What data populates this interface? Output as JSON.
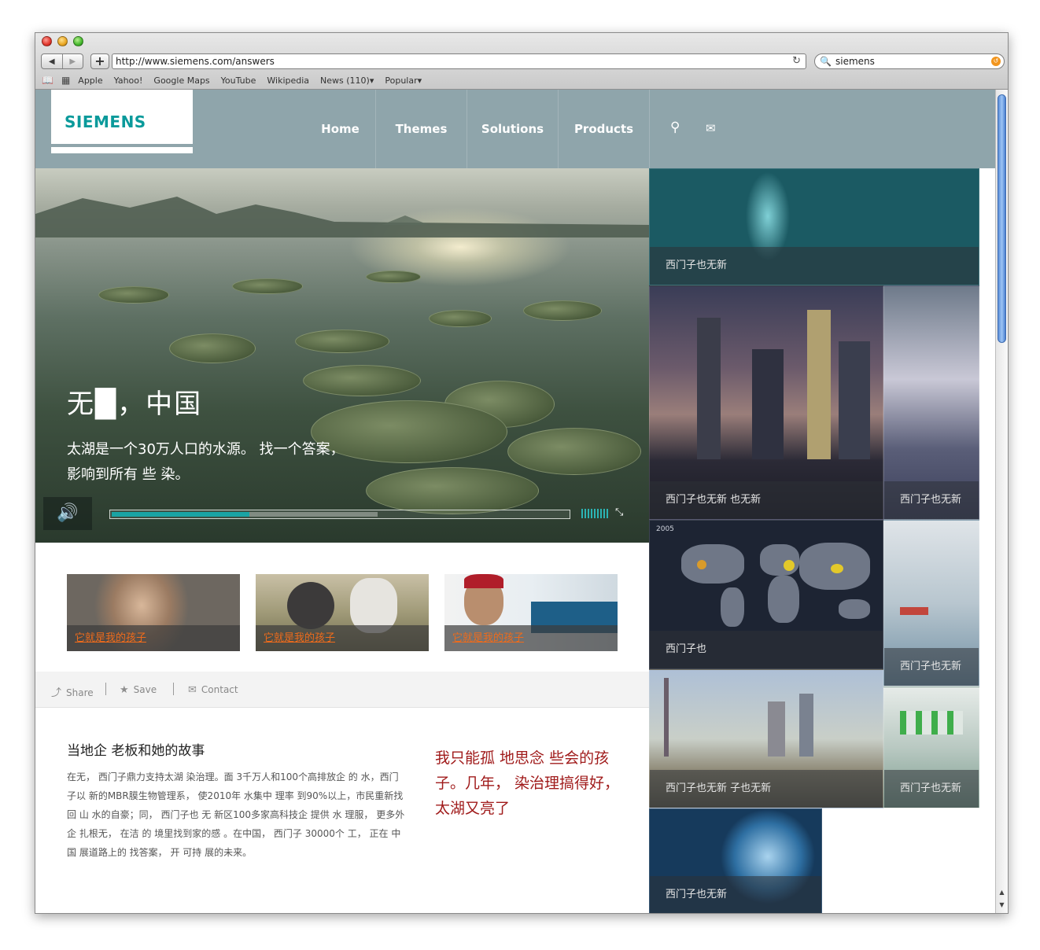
{
  "browser": {
    "back_icon": "◀",
    "forward_icon": "▶",
    "add_icon": "+",
    "url": "http://www.siemens.com/answers",
    "reload_icon": "↻",
    "search_value": "siemens",
    "search_icon": "🔍",
    "bookmarks": [
      "Apple",
      "Yahoo!",
      "Google Maps",
      "YouTube",
      "Wikipedia",
      "News (110)▾",
      "Popular▾"
    ]
  },
  "site": {
    "logo": "SIEMENS",
    "brand_color": "#0a9a9b",
    "header_color": "#8fa5ab",
    "nav": [
      "Home",
      "Themes",
      "Solutions",
      "Products"
    ],
    "search_icon": "⚲",
    "mail_icon": "✉"
  },
  "hero": {
    "title": "无█，中国",
    "subtitle_line1": "太湖是一个30万人口的水源。 找一个答案，",
    "subtitle_line2": "影响到所有 些 染。",
    "mute_icon": "🔊",
    "fullscreen_icon": "⤡",
    "progress_played": 0.3,
    "progress_buffered": 0.58
  },
  "thumbs": [
    {
      "caption": "它就是我的孩子"
    },
    {
      "caption": "它就是我的孩子"
    },
    {
      "caption": "它就是我的孩子"
    }
  ],
  "actions": {
    "share": "Share",
    "save": "Save",
    "contact": "Contact"
  },
  "story": {
    "title": "当地企 老板和她的故事",
    "body": "在无， 西门子鼎力支持太湖 染治理。面 3千万人和100个高排放企 的 水，西门子以 新的MBR膜生物管理系， 使2010年 水集中 理率 到90%以上，市民重新找回 山 水的自豪；同， 西门子也 无 新区100多家高科技企 提供 水 理服， 更多外 企 扎根无， 在洁 的 境里找到家的感 。在中国， 西门子 30000个 工， 正在 中国  展道路上的 找答案， 开 可持 展的未来。",
    "quote": "我只能孤 地思念 些会的孩子。几年， 染治理搞得好，太湖又亮了"
  },
  "tiles": [
    {
      "label": "西门子也无新"
    },
    {
      "label": "西门子也无新 也无新"
    },
    {
      "label": "西门子也无新"
    },
    {
      "label": "西门子也",
      "year": "2005"
    },
    {
      "label": "西门子也无新"
    },
    {
      "label": "西门子也无新 子也无新"
    },
    {
      "label": "西门子也无新"
    },
    {
      "label": "西门子也无新"
    }
  ]
}
